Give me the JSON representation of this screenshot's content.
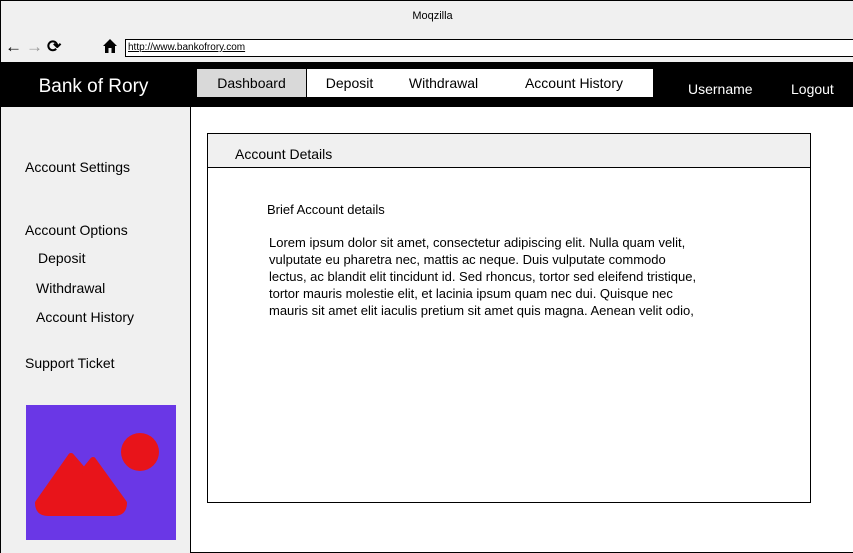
{
  "window": {
    "title": "Moqzilla"
  },
  "browser": {
    "back_icon": "←",
    "forward_icon": "→",
    "reload_icon": "⟳",
    "home_icon": "⌂",
    "url": "http://www.bankofrory.com"
  },
  "brand": {
    "name": "Bank of Rory"
  },
  "tabs": [
    {
      "label": "Dashboard",
      "active": true
    },
    {
      "label": "Deposit",
      "active": false
    },
    {
      "label": "Withdrawal",
      "active": false
    },
    {
      "label": "Account History",
      "active": false
    }
  ],
  "user_nav": {
    "username": "Username",
    "logout": "Logout"
  },
  "sidebar": {
    "account_settings": "Account Settings",
    "account_options": "Account Options",
    "options": [
      "Deposit",
      "Withdrawal",
      "Account History"
    ],
    "support_ticket": "Support Ticket",
    "image_icon": "image-placeholder-icon"
  },
  "card": {
    "header": "Account Details",
    "subtitle": "Brief Account details",
    "body": "Lorem ipsum dolor sit amet, consectetur adipiscing elit. Nulla quam velit, vulputate eu pharetra nec, mattis ac neque. Duis vulputate commodo lectus, ac blandit elit tincidunt id. Sed rhoncus, tortor sed eleifend tristique, tortor mauris molestie elit, et lacinia ipsum quam nec dui. Quisque nec mauris sit amet elit iaculis pretium sit amet quis magna. Aenean velit odio,"
  },
  "colors": {
    "navbar": "#000000",
    "panel_gray": "#f0f0f0",
    "active_tab": "#d9d9d9",
    "image_bg": "#6a37e6",
    "image_fg": "#e8141a"
  }
}
